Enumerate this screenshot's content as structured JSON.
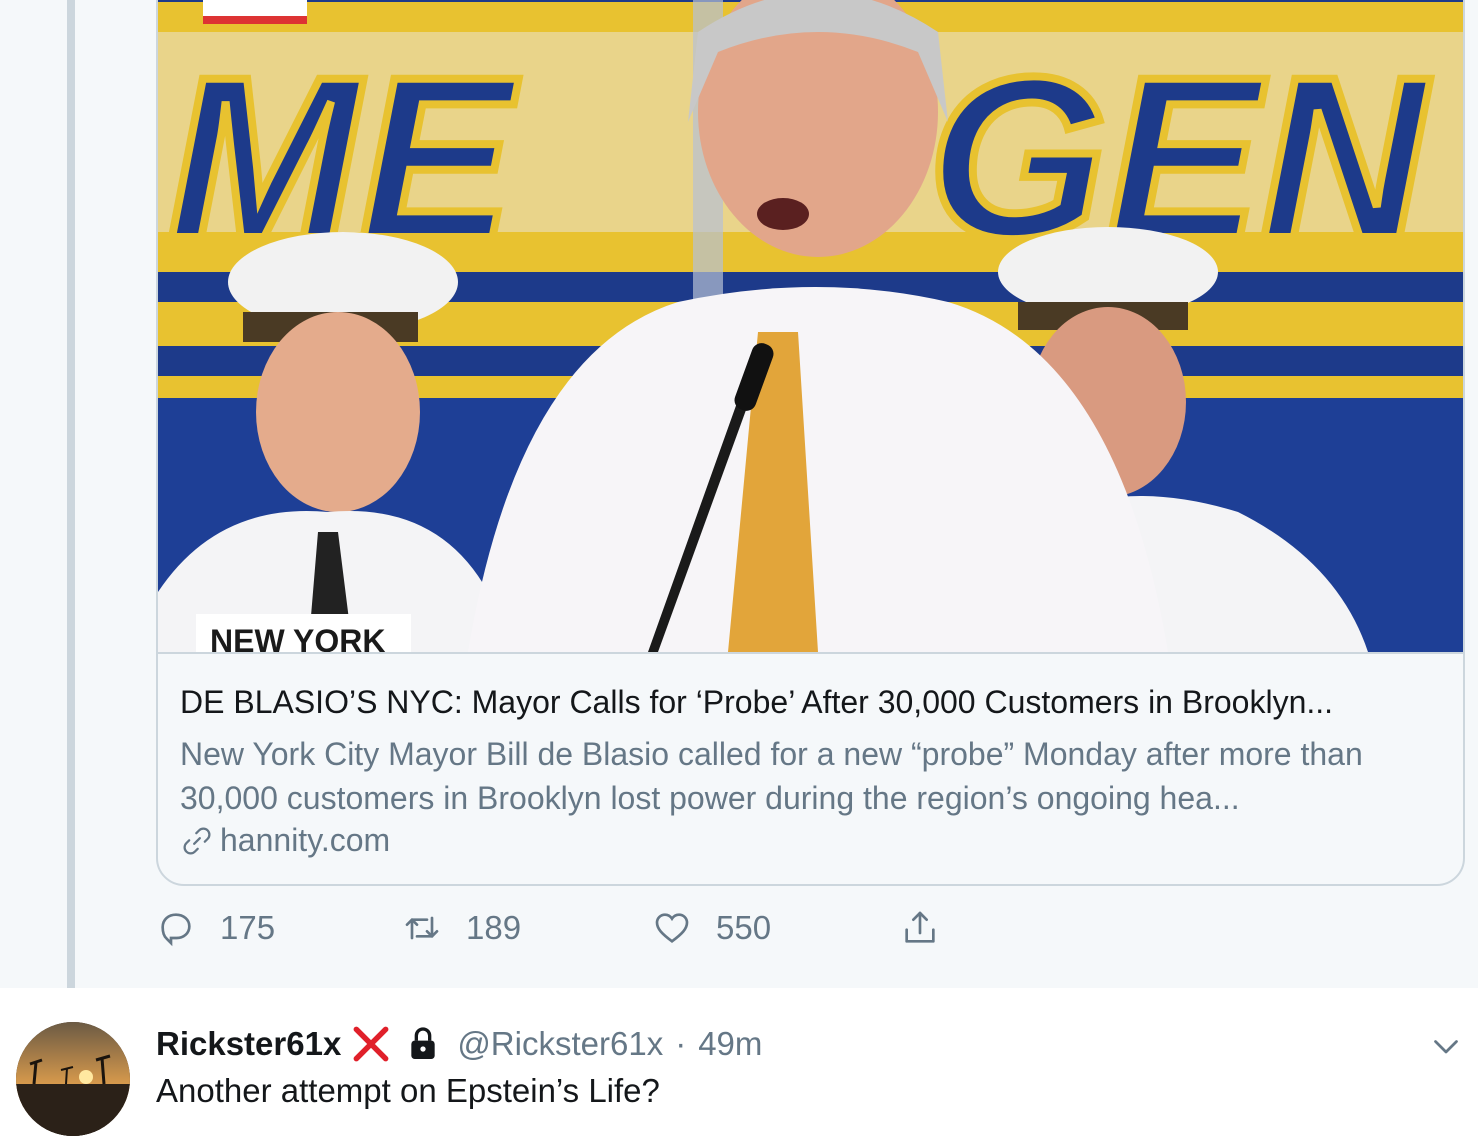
{
  "card": {
    "image_caption": "NEW YORK",
    "title": "DE BLASIO’S NYC: Mayor Calls for ‘Probe’ After 30,000 Customers in Brooklyn...",
    "description": "New York City Mayor Bill de Blasio called for a new “probe” Monday after more than 30,000 customers in Brooklyn lost power during the region’s ongoing hea...",
    "domain": "hannity.com"
  },
  "actions": {
    "replies": "175",
    "retweets": "189",
    "likes": "550"
  },
  "tweet2": {
    "name": "Rickster61x",
    "handle": "@Rickster61x",
    "separator": "·",
    "time": "49m",
    "text": "Another attempt on Epstein’s Life?"
  },
  "colors": {
    "secondary_text": "#657786",
    "primary_text": "#14171a",
    "thread_line": "#ccd6dd",
    "background_focus": "#f5f8fa",
    "red_x": "#e0202a"
  },
  "icons": [
    "reply-icon",
    "retweet-icon",
    "like-icon",
    "share-icon",
    "link-icon",
    "red-x-icon",
    "lock-icon",
    "chevron-down-icon"
  ]
}
